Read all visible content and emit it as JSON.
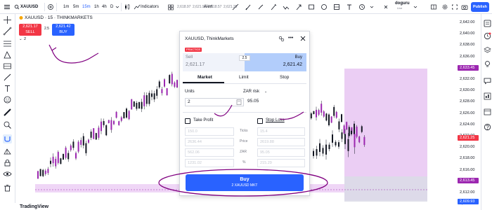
{
  "toolbar": {
    "symbol": "XAUUSD",
    "intervals": [
      "1m",
      "5m",
      "15m",
      "1h",
      "4h",
      "D"
    ],
    "selected_interval": "15m",
    "indicators_label": "Indicators",
    "prices": [
      "2,618.97",
      "2,621.90",
      "2,618.57",
      "2,621.25"
    ],
    "alert_label": "Alert",
    "account_name": "doguru",
    "account_sub": "Live",
    "publish_label": "Publish"
  },
  "legend": {
    "title": "XAUUSD · 15 · THINKMARKETS",
    "sell_price": "2,621.17",
    "sell_label": "SELL",
    "spread": "2.5",
    "buy_price": "2,621.42",
    "buy_label": "BUY",
    "indicator_count": "2"
  },
  "price_axis": {
    "labels": [
      "2,642.00",
      "2,640.00",
      "2,638.00",
      "2,636.00",
      "2,634.00",
      "2,632.00",
      "2,630.00",
      "2,628.00",
      "2,626.00",
      "2,624.00",
      "2,622.00",
      "2,620.00",
      "2,618.00",
      "2,616.00",
      "2,614.00",
      "2,612.00",
      "2,610.00"
    ],
    "tag_top": "2,633.45",
    "tag_current": "2,621.25",
    "tag_low": "2,613.45",
    "tag_bottom": "2,609.93",
    "colors": {
      "tag_top": "#9c27b0",
      "tag_current": "#f23645",
      "tag_low": "#9c27b0",
      "tag_bottom": "#2962ff"
    }
  },
  "panel": {
    "title": "XAUUSD, ThinkMarkets",
    "live_badge": "PRACTICE",
    "sell_label": "Sell",
    "sell_price": "2,621.17",
    "spread": "2.5",
    "buy_label": "Buy",
    "buy_price": "2,621.42",
    "tabs": [
      "Market",
      "Limit",
      "Stop"
    ],
    "active_tab": "Market",
    "units_label": "Units",
    "risk_label": "ZAR risk",
    "units_value": "2",
    "risk_value": "95.05",
    "take_profit_label": "Take Profit",
    "stop_loss_label": "Stop Loss",
    "mid_labels": [
      "Ticks",
      "Price",
      "ZAR",
      "%"
    ],
    "tp_values": [
      "150.0",
      "2636.44",
      "562.06",
      "1231.02"
    ],
    "sl_values": [
      "15.4",
      "2619.88",
      "95.05",
      "215.29"
    ],
    "buy_button_label": "Buy",
    "buy_button_sub": "2 XAUUSD MKT"
  },
  "footer": {
    "watermark": "TradingView"
  },
  "colors": {
    "accent": "#2962ff",
    "sell": "#f23645",
    "annotation": "#800080",
    "zone": "#e1bee7"
  }
}
